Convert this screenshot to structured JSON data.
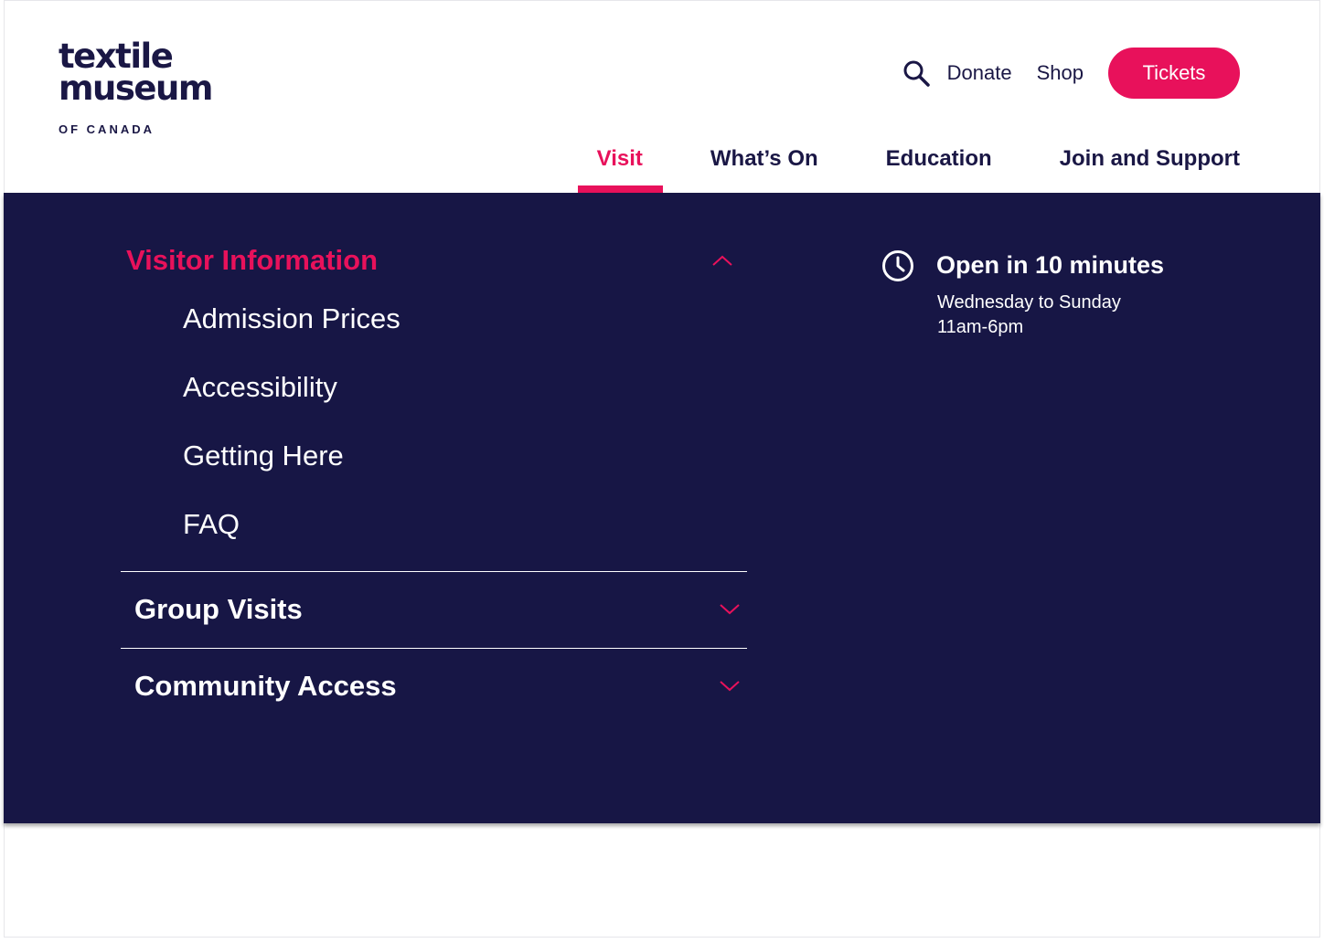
{
  "logo": {
    "line1": "textile",
    "line2": "museum",
    "line3": "OF CANADA"
  },
  "utility_nav": {
    "donate": "Donate",
    "shop": "Shop",
    "tickets": "Tickets"
  },
  "main_nav": {
    "tabs": [
      "Visit",
      "What’s On",
      "Education",
      "Join and Support"
    ],
    "active": "Visit"
  },
  "mega_menu": {
    "sections": [
      {
        "title": "Visitor Information",
        "expanded": true,
        "links": [
          "Admission Prices",
          "Accessibility",
          "Getting Here",
          "FAQ"
        ]
      },
      {
        "title": "Group Visits",
        "expanded": false
      },
      {
        "title": "Community Access",
        "expanded": false
      }
    ],
    "hours": {
      "status": "Open in 10 minutes",
      "days": "Wednesday to Sunday",
      "time": "11am-6pm"
    }
  },
  "colors": {
    "navy": "#171645",
    "accent": "#e8115b",
    "logo": "#1a1745"
  },
  "icons": {
    "search": "search-icon",
    "clock": "clock-icon",
    "chevron_up": "chevron-up-icon",
    "chevron_down": "chevron-down-icon"
  }
}
